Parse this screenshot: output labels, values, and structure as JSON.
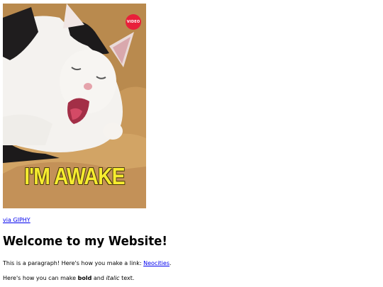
{
  "gif": {
    "caption": "I'M AWAKE",
    "badge": "VIDEO"
  },
  "via": {
    "prefix": "via ",
    "link": "GIPHY"
  },
  "heading": "Welcome to my Website!",
  "para1": {
    "text": "This is a paragraph! Here's how you make a link: ",
    "link": "Neocities",
    "suffix": "."
  },
  "para2": {
    "before": "Here's how you can make ",
    "bold": "bold",
    "middle": " and ",
    "italic": "italic",
    "after": " text."
  }
}
